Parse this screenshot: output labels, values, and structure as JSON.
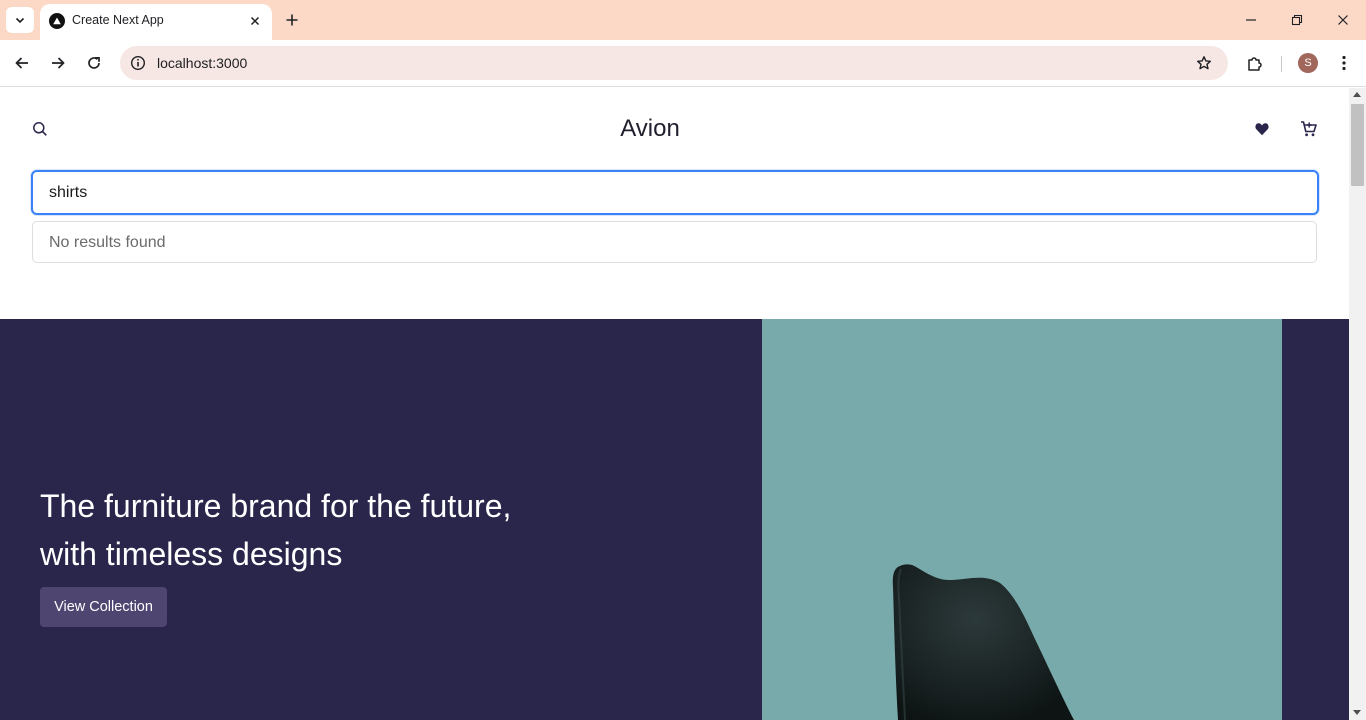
{
  "browser": {
    "tab_title": "Create Next App",
    "url": "localhost:3000",
    "profile_initial": "S"
  },
  "colors": {
    "tabstrip": "#fbd9c6",
    "hero_bg": "#2a254b",
    "hero_image_bg": "#78aaab",
    "focus_ring": "#3b82f6",
    "button_bg": "#4e4670"
  },
  "header": {
    "logo": "Avion",
    "icons": [
      "search-icon",
      "heart-icon",
      "cart-icon"
    ]
  },
  "search": {
    "value": "shirts",
    "results_message": "No results found"
  },
  "hero": {
    "title_line1": "The furniture brand for the future,",
    "title_line2": "with timeless designs",
    "cta_label": "View Collection"
  }
}
